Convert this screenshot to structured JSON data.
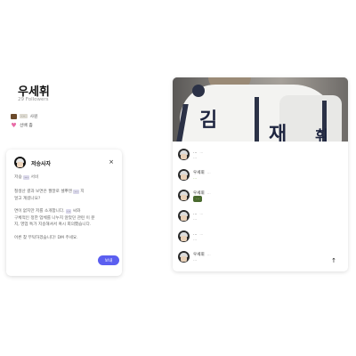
{
  "profile": {
    "name": "우세휘",
    "followers": "29 Followers",
    "job_text": "...",
    "job_suffix": "사원",
    "like_text": "선배 좀"
  },
  "message": {
    "title": "저승사자",
    "close_label": "×",
    "sub_prefix": "저승",
    "sub_highlight": "...",
    "sub_suffix": "서비",
    "p1_a": "철생산 결과 보면은 월말로 셀뿌엔",
    "p1_highlight": "...",
    "p1_b": "지",
    "p1_c": "얼고 계셨나요?",
    "p2_a": "면이 없지만 저를 소개합니다.",
    "p2_highlight": "...",
    "p2_b": "씨와",
    "p2_c": "구체적인 정한 업체를 나누지 않았던 관련 이 분",
    "p2_d": "지, 영업 특가 지송해셔서 혹시 회의했습니다.",
    "p3": "어른 찾 부탁하겠습니다! DM 주세요.",
    "send_label": "보내"
  },
  "comments": [
    {
      "name": "...",
      "time": "...",
      "text": "...",
      "style": "grey"
    },
    {
      "name": "우세휘",
      "time": "...",
      "text": "...",
      "style": "green"
    },
    {
      "name": "우세휘",
      "time": "...",
      "text": "...",
      "style": "chip"
    },
    {
      "name": "...",
      "time": "...",
      "text": "...",
      "style": "grey"
    },
    {
      "name": "...",
      "time": "...",
      "text": "...",
      "style": "grey"
    },
    {
      "name": "우세휘",
      "time": "...",
      "text": "...",
      "style": "grey"
    }
  ],
  "photo": {
    "jersey_letters": [
      "김",
      "재",
      "휘"
    ]
  },
  "scroll_top_icon": "arrow-up-icon",
  "colors": {
    "accent": "#5b5ff0",
    "highlight": "#d9d7ea",
    "chip_bg": "#4a6a2f",
    "green_text": "#7aa84a"
  }
}
